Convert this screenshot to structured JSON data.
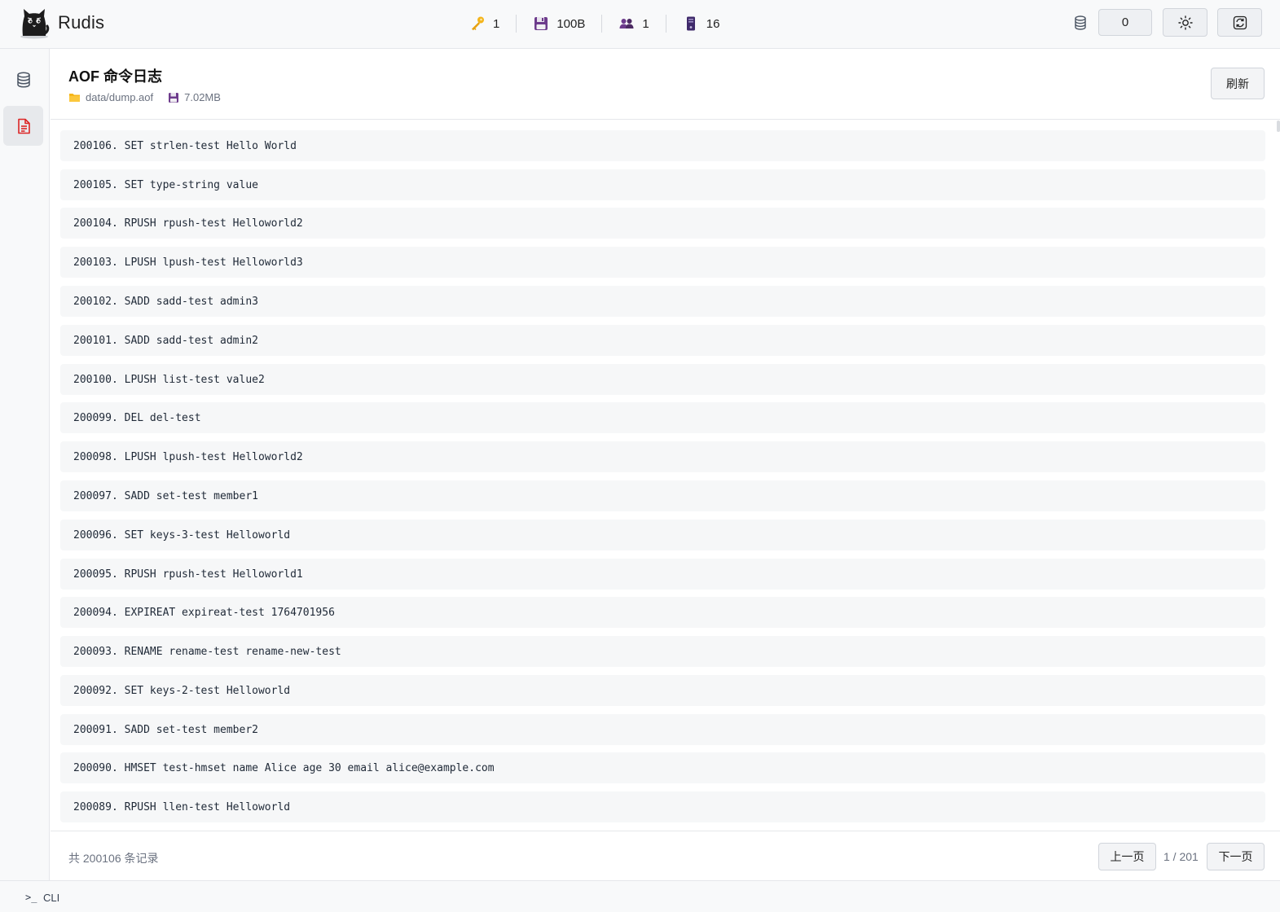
{
  "app": {
    "name": "Rudis"
  },
  "header": {
    "stats": [
      {
        "icon": "key-icon",
        "value": "1"
      },
      {
        "icon": "floppy-disk-icon",
        "value": "100B"
      },
      {
        "icon": "users-icon",
        "value": "1"
      },
      {
        "icon": "server-icon",
        "value": "16"
      }
    ],
    "db_index": "0"
  },
  "sidebar": {
    "items": [
      {
        "icon": "database-icon",
        "active": false
      },
      {
        "icon": "document-icon",
        "active": true
      }
    ]
  },
  "page": {
    "title": "AOF 命令日志",
    "file_path": "data/dump.aof",
    "file_size": "7.02MB",
    "refresh_label": "刷新"
  },
  "logs": [
    "200106. SET strlen-test Hello World",
    "200105. SET type-string value",
    "200104. RPUSH rpush-test Helloworld2",
    "200103. LPUSH lpush-test Helloworld3",
    "200102. SADD sadd-test admin3",
    "200101. SADD sadd-test admin2",
    "200100. LPUSH list-test value2",
    "200099. DEL del-test",
    "200098. LPUSH lpush-test Helloworld2",
    "200097. SADD set-test member1",
    "200096. SET keys-3-test Helloworld",
    "200095. RPUSH rpush-test Helloworld1",
    "200094. EXPIREAT expireat-test 1764701956",
    "200093. RENAME rename-test rename-new-test",
    "200092. SET keys-2-test Helloworld",
    "200091. SADD set-test member2",
    "200090. HMSET test-hmset name Alice age 30 email alice@example.com",
    "200089. RPUSH llen-test Helloworld"
  ],
  "footer": {
    "total": "共 200106 条记录",
    "prev_label": "上一页",
    "page_info": "1 / 201",
    "next_label": "下一页"
  },
  "cli": {
    "prompt": ">_",
    "label": "CLI"
  },
  "colors": {
    "accent_red": "#dc2626",
    "folder_yellow": "#f6b619",
    "disk_purple": "#6d3b8c"
  }
}
